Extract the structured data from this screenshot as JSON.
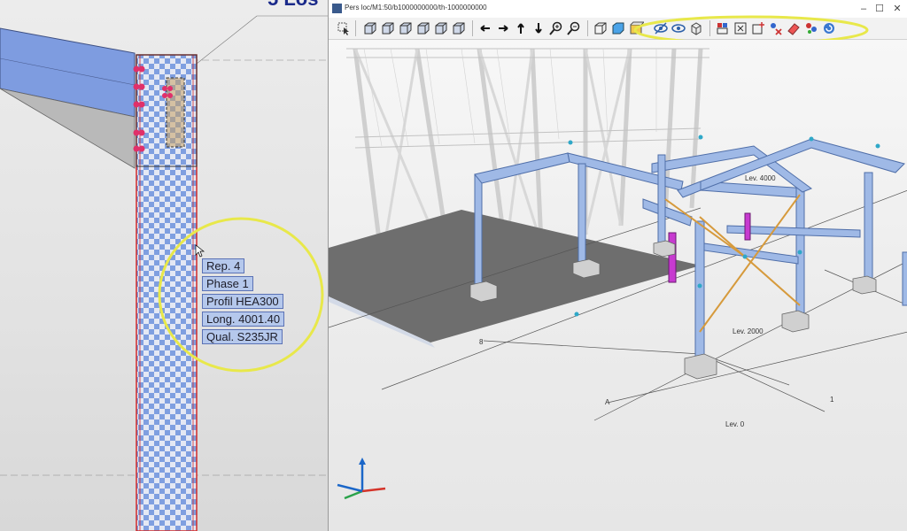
{
  "window": {
    "title": "Pers loc/M1:50/b1000000000/th-1000000000",
    "minimize_glyph": "–",
    "maximize_glyph": "☐",
    "close_glyph": "✕"
  },
  "left_view": {
    "heading_fragment": "5 Los",
    "tooltip": {
      "rep": "Rep.  4",
      "phase": "Phase 1",
      "profil": "Profil  HEA300",
      "long": "Long. 4001.40",
      "qual": "Qual.  S235JR"
    }
  },
  "toolbar": {
    "icons": [
      "select-cursor-icon",
      "cube-front-icon",
      "cube-back-icon",
      "cube-left-icon",
      "cube-right-icon",
      "cube-top-icon",
      "cube-iso-icon",
      "pan-left-icon",
      "pan-right-icon",
      "pan-up-icon",
      "pan-down-icon",
      "zoom-in-icon",
      "zoom-out-icon",
      "box-wire-icon",
      "box-solid-icon",
      "render-icon",
      "hide-eye-icon",
      "show-eye-icon",
      "box-display-icon",
      "flag-icon",
      "grid-delete-icon",
      "add-icon",
      "remove-icon",
      "clear-icon",
      "eraser-icon",
      "multi-icon",
      "refresh-icon"
    ]
  },
  "viewport": {
    "labels": {
      "lev_2000": "Lev. 2000",
      "lev_0": "Lev. 0",
      "lev_4000": "Lev. 4000",
      "axis_1": "1",
      "axis_A": "A",
      "axis_8": "8"
    }
  },
  "colors": {
    "steel_blue": "#9fb9e6",
    "highlight_yellow": "#e8e84a",
    "selected_magenta": "#c73ad0",
    "brace_orange": "#d69a3c",
    "slab_gray": "#6e6e6e"
  }
}
